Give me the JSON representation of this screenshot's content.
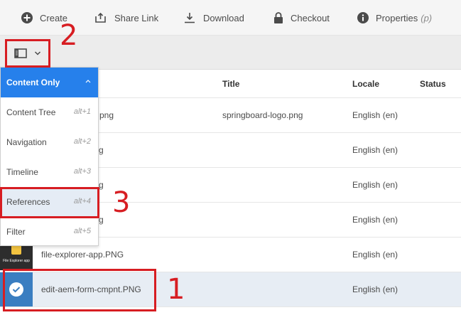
{
  "toolbar": {
    "create": "Create",
    "share_link": "Share Link",
    "download": "Download",
    "checkout": "Checkout",
    "properties": "Properties",
    "properties_hint": "(p)"
  },
  "table": {
    "headers": {
      "title": "Title",
      "locale": "Locale",
      "status": "Status"
    },
    "rows": [
      {
        "name": "o.png",
        "title": "springboard-logo.png",
        "locale": "English (en)"
      },
      {
        "name": "g",
        "title": "",
        "locale": "English (en)"
      },
      {
        "name": "g",
        "title": "",
        "locale": "English (en)"
      },
      {
        "name": "g",
        "title": "",
        "locale": "English (en)"
      },
      {
        "name": "file-explorer-app.PNG",
        "title": "",
        "locale": "English (en)",
        "thumb_text": "File Explorer app"
      },
      {
        "name": "edit-aem-form-cmpnt.PNG",
        "title": "",
        "locale": "English (en)"
      }
    ]
  },
  "view_menu": {
    "items": [
      {
        "label": "Content Only",
        "key": ""
      },
      {
        "label": "Content Tree",
        "key": "alt+1"
      },
      {
        "label": "Navigation",
        "key": "alt+2"
      },
      {
        "label": "Timeline",
        "key": "alt+3"
      },
      {
        "label": "References",
        "key": "alt+4"
      },
      {
        "label": "Filter",
        "key": "alt+5"
      }
    ]
  },
  "annotations": {
    "one": "1",
    "two": "2",
    "three": "3"
  },
  "colors": {
    "accent": "#2680eb",
    "annotation": "#d71d22",
    "selected_row": "#e7edf4"
  }
}
